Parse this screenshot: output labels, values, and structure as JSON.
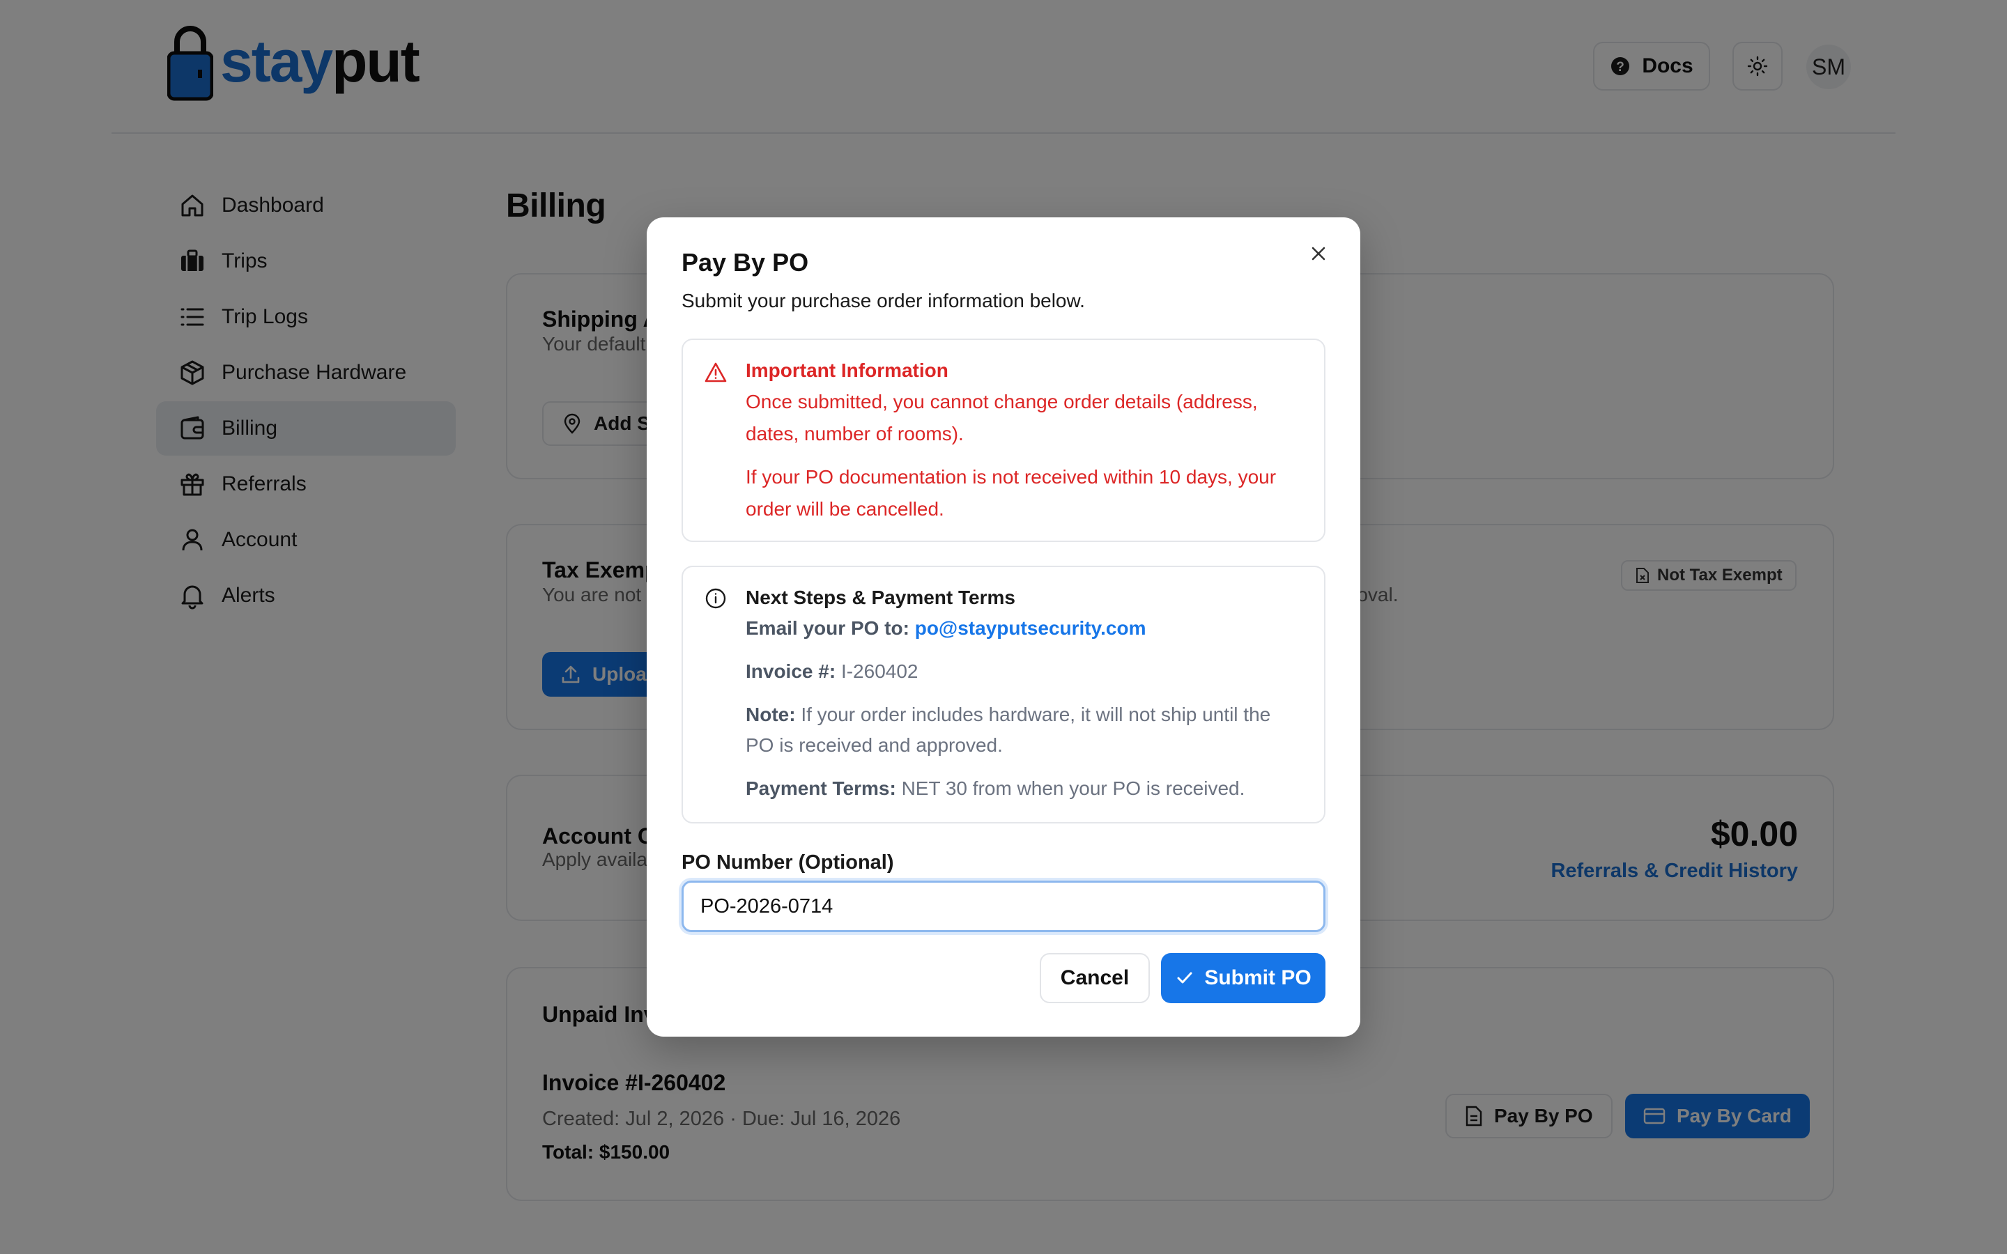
{
  "brand": {
    "part1": "stay",
    "part2": "put"
  },
  "header": {
    "docs_label": "Docs",
    "avatar_initials": "SM"
  },
  "sidebar": {
    "items": [
      {
        "label": "Dashboard"
      },
      {
        "label": "Trips"
      },
      {
        "label": "Trip Logs"
      },
      {
        "label": "Purchase Hardware"
      },
      {
        "label": "Billing"
      },
      {
        "label": "Referrals"
      },
      {
        "label": "Account"
      },
      {
        "label": "Alerts"
      }
    ],
    "active": "Billing"
  },
  "main": {
    "title": "Billing",
    "shipping": {
      "title": "Shipping A",
      "subtitle": "Your default",
      "button": "Add S"
    },
    "tax": {
      "title": "Tax Exemp",
      "subtitle": "You are not",
      "subtitle_right": "roval.",
      "badge": "Not Tax Exempt",
      "button": "Uploa"
    },
    "credit": {
      "title": "Account C",
      "subtitle": "Apply availa",
      "amount": "$0.00",
      "link": "Referrals & Credit History"
    },
    "unpaid": {
      "title": "Unpaid Inv",
      "invoice_title": "Invoice #I-260402",
      "meta": "Created: Jul 2, 2026 · Due: Jul 16, 2026",
      "total": "Total: $150.00",
      "pay_po": "Pay By PO",
      "pay_card": "Pay By Card"
    }
  },
  "modal": {
    "title": "Pay By PO",
    "description": "Submit your purchase order information below.",
    "warning": {
      "title": "Important Information",
      "line1": "Once submitted, you cannot change order details (address, dates, number of rooms).",
      "line2": "If your PO documentation is not received within 10 days, your order will be cancelled."
    },
    "info": {
      "title": "Next Steps & Payment Terms",
      "email_label": "Email your PO to:",
      "email": "po@stayputsecurity.com",
      "invoice_label": "Invoice #:",
      "invoice_value": "I-260402",
      "note_label": "Note:",
      "note_text": "If your order includes hardware, it will not ship until the PO is received and approved.",
      "terms_label": "Payment Terms:",
      "terms_text": "NET 30 from when your PO is received."
    },
    "field": {
      "label": "PO Number (Optional)",
      "value": "PO-2026-0714"
    },
    "cancel": "Cancel",
    "submit": "Submit PO"
  },
  "colors": {
    "brand_blue": "#1776e8",
    "warning_red": "#dc2626",
    "overlay": "rgba(0,0,0,0.5)"
  }
}
